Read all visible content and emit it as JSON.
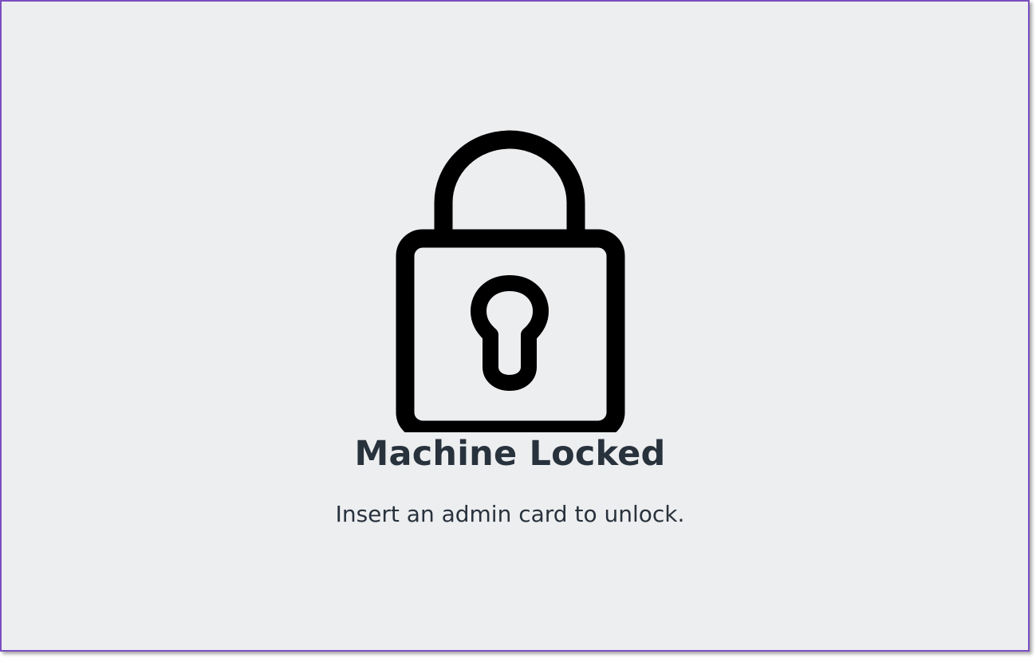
{
  "screen": {
    "title": "Machine Locked",
    "message": "Insert an admin card to unlock.",
    "icon": "lock-icon"
  },
  "colors": {
    "background": "#edeef0",
    "text": "#28323c",
    "border": "#7a4fc0",
    "icon": "#000000"
  }
}
